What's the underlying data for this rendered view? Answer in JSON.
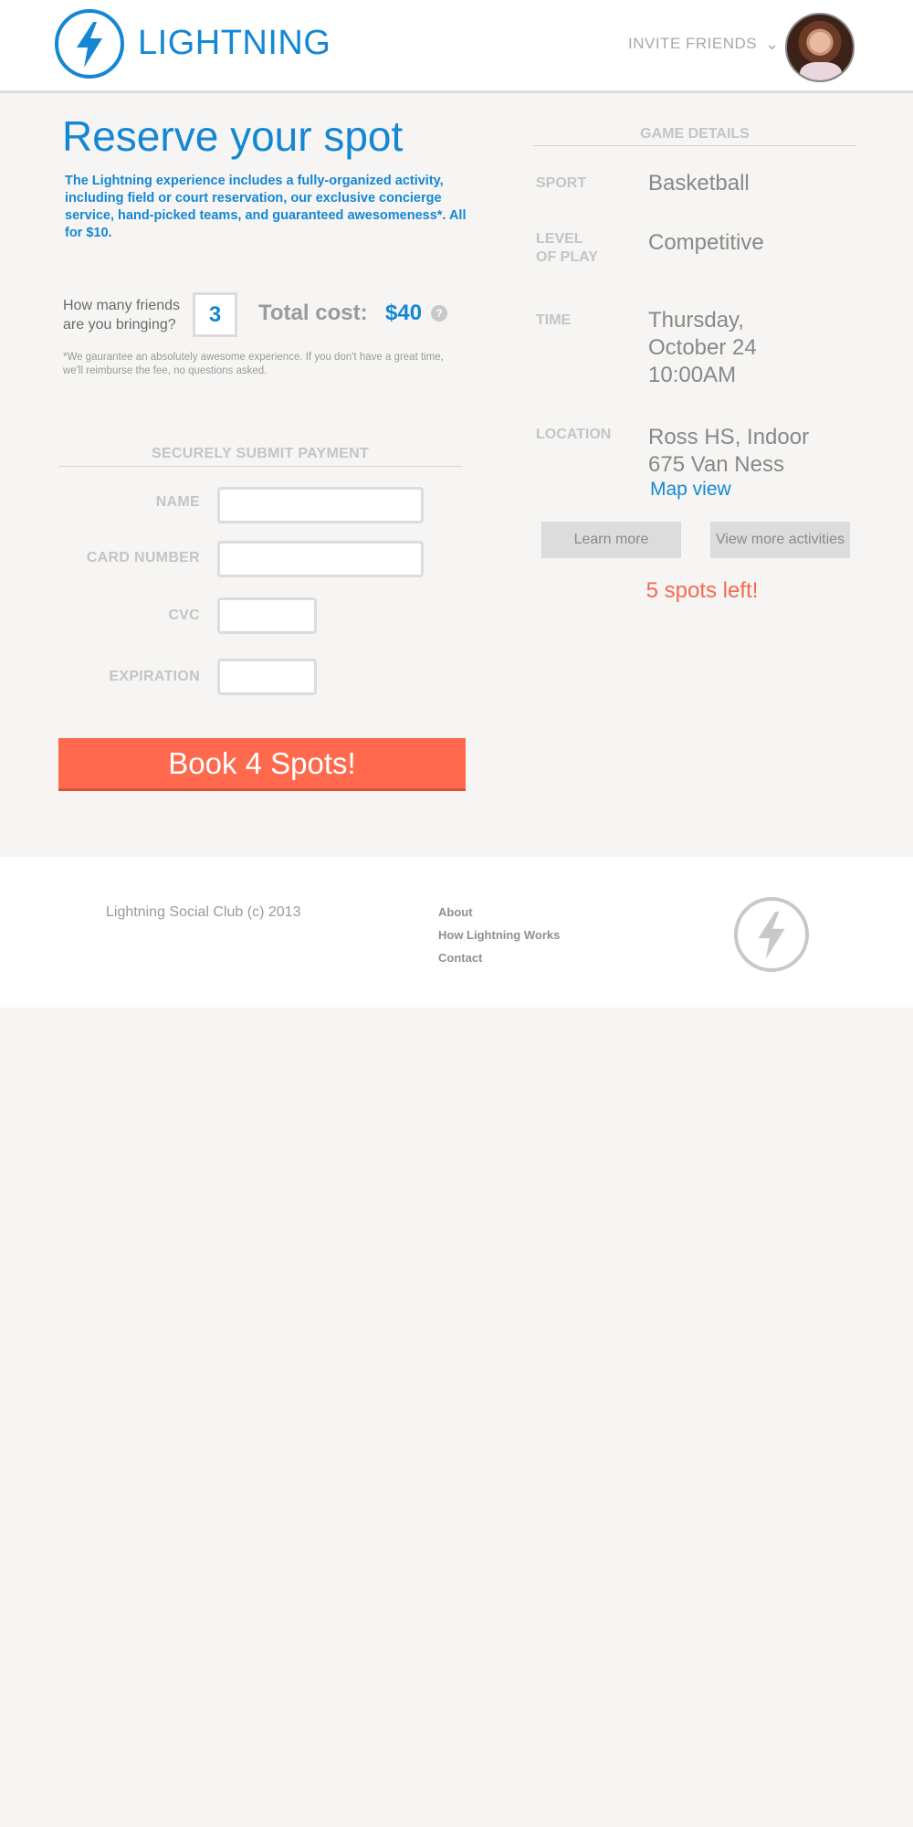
{
  "header": {
    "brand": "LIGHTNING",
    "invite_label": "INVITE FRIENDS",
    "chevron": "⌄",
    "avatar_icon": "user-avatar"
  },
  "reserve": {
    "title": "Reserve your spot",
    "intro": "The Lightning experience includes a fully-organized activity, including field or court reservation, our exclusive concierge service, hand-picked teams, and guaranteed awesomeness*. All for $10.",
    "friends_label": "How many friends are you bringing?",
    "friends_count": "3",
    "total_label": "Total cost:",
    "total_value": "$40",
    "help_glyph": "?",
    "guarantee": "*We gaurantee an absolutely awesome experience. If you don't have a great time, we'll reimburse the fee, no questions asked."
  },
  "payment": {
    "heading": "SECURELY SUBMIT PAYMENT",
    "name_label": "NAME",
    "name_value": "",
    "card_label": "CARD NUMBER",
    "card_value": "",
    "cvc_label": "CVC",
    "cvc_value": "",
    "exp_label": "EXPIRATION",
    "exp_value": "",
    "book_label": "Book 4 Spots!"
  },
  "game": {
    "heading": "GAME DETAILS",
    "sport_label": "SPORT",
    "sport_value": "Basketball",
    "level_label_1": "LEVEL",
    "level_label_2": "OF PLAY",
    "level_value": "Competitive",
    "time_label": "TIME",
    "time_line1": "Thursday,",
    "time_line2": "October 24",
    "time_line3": "10:00AM",
    "location_label": "LOCATION",
    "location_line1": "Ross HS, Indoor",
    "location_line2": "675 Van Ness",
    "map_link": "Map view",
    "learn_more": "Learn more",
    "view_more": "View more activities",
    "spots_left": "5 spots left!"
  },
  "footer": {
    "copyright": "Lightning Social Club (c) 2013",
    "links": [
      "About",
      "How Lightning Works",
      "Contact"
    ]
  },
  "colors": {
    "accent": "#1487d4",
    "cta": "#ff6a4e",
    "warning": "#f26b51"
  }
}
